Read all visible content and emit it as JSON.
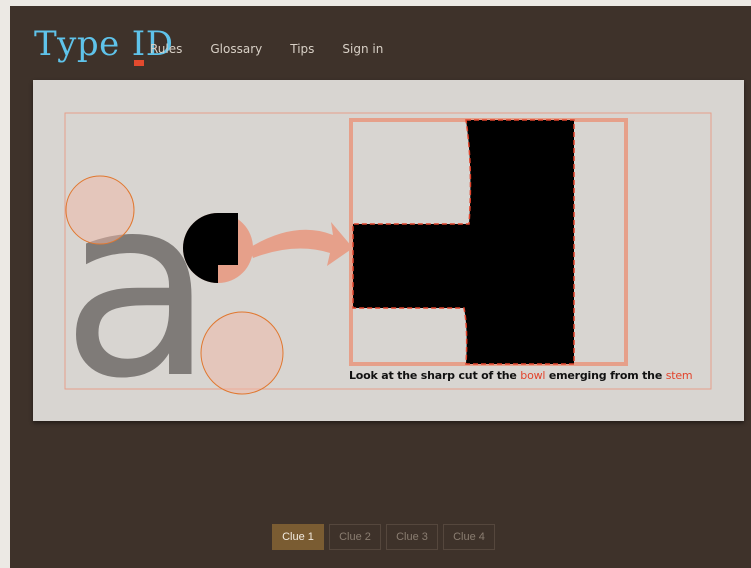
{
  "header": {
    "logo_type": "Type",
    "logo_i": "I",
    "logo_d": "D",
    "nav": [
      "Rules",
      "Glossary",
      "Tips",
      "Sign in"
    ]
  },
  "clue": {
    "caption_prefix": "Look at the sharp cut of the ",
    "caption_term1": "bowl",
    "caption_middle": " emerging from the ",
    "caption_term2": "stem",
    "illustration_glyph": "a"
  },
  "clue_tabs": {
    "items": [
      "Clue 1",
      "Clue 2",
      "Clue 3",
      "Clue 4"
    ],
    "active_index": 0
  },
  "colors": {
    "background": "#3e322a",
    "panel": "#d8d5d1",
    "logo": "#5fc3ea",
    "accent": "#e2442c",
    "highlight_circle": "#e6a08a",
    "active_tab": "#7a5c32"
  }
}
